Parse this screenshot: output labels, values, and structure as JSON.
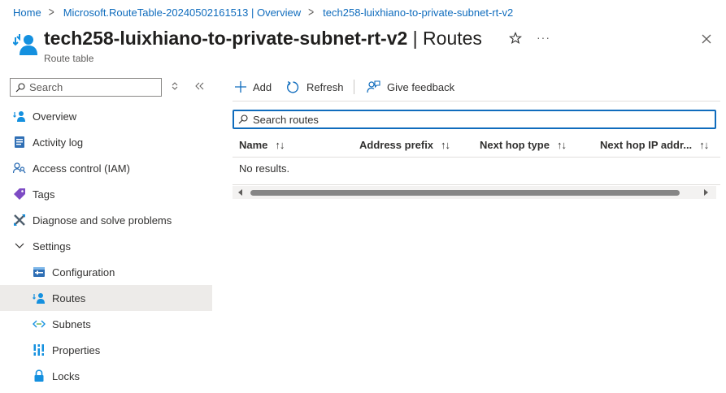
{
  "breadcrumb": {
    "items": [
      "Home",
      "Microsoft.RouteTable-20240502161513 | Overview",
      "tech258-luixhiano-to-private-subnet-rt-v2"
    ],
    "separator": ">"
  },
  "header": {
    "resource_name": "tech258-luixhiano-to-private-subnet-rt-v2",
    "page_suffix": " | Routes",
    "subtitle": "Route table",
    "more": "···"
  },
  "sidebar": {
    "search_placeholder": "Search",
    "items": [
      {
        "label": "Overview",
        "icon": "overview-icon"
      },
      {
        "label": "Activity log",
        "icon": "activity-log-icon"
      },
      {
        "label": "Access control (IAM)",
        "icon": "iam-icon"
      },
      {
        "label": "Tags",
        "icon": "tag-icon"
      },
      {
        "label": "Diagnose and solve problems",
        "icon": "wrench-icon"
      },
      {
        "label": "Settings",
        "icon": "chevron-down-icon"
      },
      {
        "label": "Configuration",
        "icon": "configuration-icon"
      },
      {
        "label": "Routes",
        "icon": "routes-icon",
        "selected": true
      },
      {
        "label": "Subnets",
        "icon": "subnet-icon"
      },
      {
        "label": "Properties",
        "icon": "properties-icon"
      },
      {
        "label": "Locks",
        "icon": "lock-icon"
      }
    ]
  },
  "toolbar": {
    "add_label": "Add",
    "refresh_label": "Refresh",
    "feedback_label": "Give feedback"
  },
  "routes": {
    "search_placeholder": "Search routes",
    "columns": [
      "Name",
      "Address prefix",
      "Next hop type",
      "Next hop IP addr..."
    ],
    "sort_glyph": "↑↓",
    "empty_text": "No results."
  },
  "colors": {
    "accent": "#0f6cbd",
    "selected_nav": "#edebe9",
    "text": "#323130"
  }
}
